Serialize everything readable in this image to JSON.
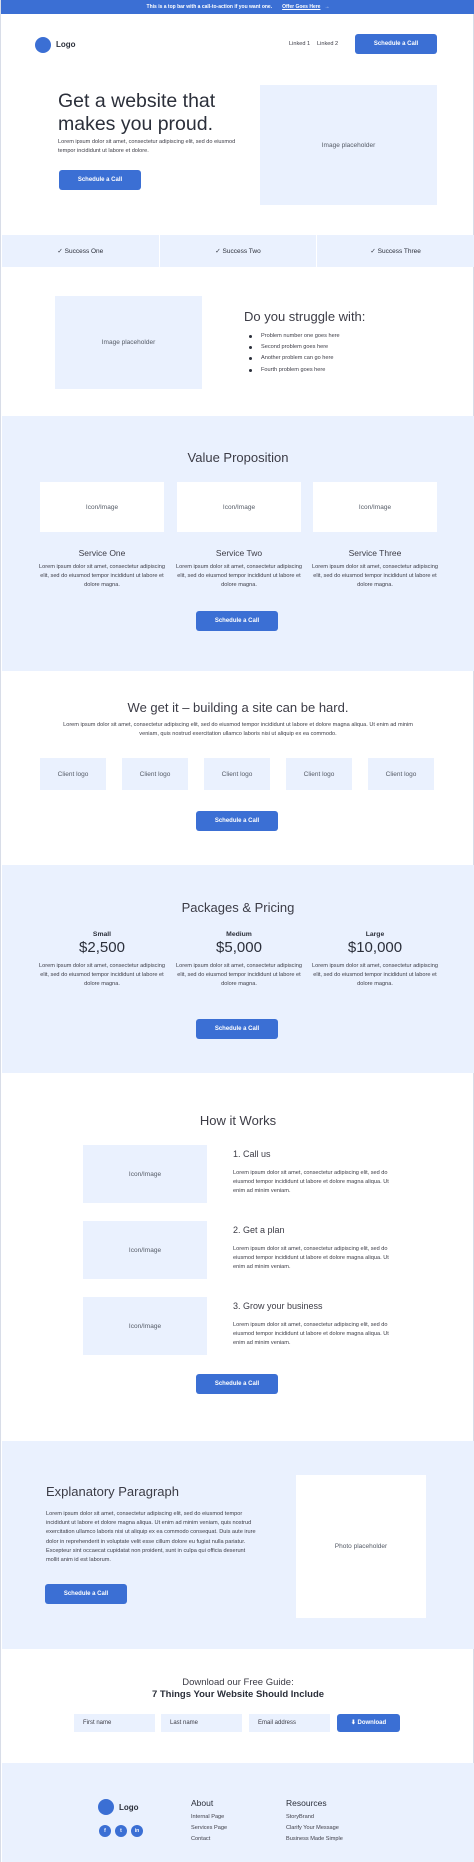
{
  "topbar": {
    "text": "This is a top bar with a call-to-action if you want one.",
    "link": "Offer Goes Here",
    "arrow": "→"
  },
  "header": {
    "logo": "Logo",
    "nav": [
      "Linked 1",
      "Linked 2"
    ],
    "cta": "Schedule a Call"
  },
  "hero": {
    "title_line1": "Get a website that",
    "title_line2": "makes you proud.",
    "text": "Lorem ipsum dolor sit amet, consectetur adipiscing elit, sed do eiusmod tempor incididunt ut labore et dolore.",
    "cta": "Schedule a Call",
    "image": "Image placeholder"
  },
  "success": [
    "✓ Success One",
    "✓ Success Two",
    "✓ Success Three"
  ],
  "struggle": {
    "image": "Image placeholder",
    "title": "Do you struggle with:",
    "items": [
      "Problem number one goes here",
      "Second problem goes here",
      "Another problem can go here",
      "Fourth problem goes here"
    ]
  },
  "value": {
    "title": "Value Proposition",
    "icon_label": "Icon/Image",
    "services": [
      {
        "title": "Service One",
        "text": "Lorem ipsum dolor sit amet, consectetur adipiscing elit, sed do eiusmod tempor incididunt ut labore et dolore magna."
      },
      {
        "title": "Service Two",
        "text": "Lorem ipsum dolor sit amet, consectetur adipiscing elit, sed do eiusmod tempor incididunt ut labore et dolore magna."
      },
      {
        "title": "Service Three",
        "text": "Lorem ipsum dolor sit amet, consectetur adipiscing elit, sed do eiusmod tempor incididunt ut labore et dolore magna."
      }
    ],
    "cta": "Schedule a Call"
  },
  "getit": {
    "title": "We get it – building a site can be hard.",
    "text": "Lorem ipsum dolor sit amet, consectetur adipiscing elit, sed do eiusmod tempor incididunt ut labore et dolore magna aliqua. Ut enim ad minim veniam, quis nostrud exercitation ullamco laboris nisi ut aliquip ex ea commodo.",
    "clients": [
      "Client logo",
      "Client logo",
      "Client logo",
      "Client logo",
      "Client logo"
    ],
    "cta": "Schedule a Call"
  },
  "pricing": {
    "title": "Packages & Pricing",
    "packages": [
      {
        "name": "Small",
        "price": "$2,500",
        "text": "Lorem ipsum dolor sit amet, consectetur adipiscing elit, sed do eiusmod tempor incididunt ut labore et dolore magna."
      },
      {
        "name": "Medium",
        "price": "$5,000",
        "text": "Lorem ipsum dolor sit amet, consectetur adipiscing elit, sed do eiusmod tempor incididunt ut labore et dolore magna."
      },
      {
        "name": "Large",
        "price": "$10,000",
        "text": "Lorem ipsum dolor sit amet, consectetur adipiscing elit, sed do eiusmod tempor incididunt ut labore et dolore magna."
      }
    ],
    "cta": "Schedule a Call"
  },
  "how": {
    "title": "How it Works",
    "icon_label": "Icon/Image",
    "steps": [
      {
        "title": "1. Call us",
        "text": "Lorem ipsum dolor sit amet, consectetur adipiscing elit, sed do eiusmod tempor incididunt ut labore et dolore magna aliqua. Ut enim ad minim veniam."
      },
      {
        "title": "2. Get a plan",
        "text": "Lorem ipsum dolor sit amet, consectetur adipiscing elit, sed do eiusmod tempor incididunt ut labore et dolore magna aliqua. Ut enim ad minim veniam."
      },
      {
        "title": "3. Grow your business",
        "text": "Lorem ipsum dolor sit amet, consectetur adipiscing elit, sed do eiusmod tempor incididunt ut labore et dolore magna aliqua. Ut enim ad minim veniam."
      }
    ],
    "cta": "Schedule a Call"
  },
  "explanatory": {
    "title": "Explanatory Paragraph",
    "text": "Lorem ipsum dolor sit amet, consectetur adipiscing elit, sed do eiusmod tempor incididunt ut labore et dolore magna aliqua. Ut enim ad minim veniam, quis nostrud exercitation ullamco laboris nisi ut aliquip ex ea commodo consequat. Duis aute irure dolor in reprehenderit in voluptate velit esse cillum dolore eu fugiat nulla pariatur. Excepteur sint occaecat cupidatat non proident, sunt in culpa qui officia deserunt mollit anim id est laborum.",
    "cta": "Schedule a Call",
    "photo": "Photo placeholder"
  },
  "guide": {
    "line1": "Download our Free Guide:",
    "line2": "7 Things Your Website Should Include",
    "first_name": "First name",
    "last_name": "Last name",
    "email": "Email address",
    "download": "⬇ Download"
  },
  "footer": {
    "logo": "Logo",
    "social": [
      "f",
      "t",
      "in"
    ],
    "about_title": "About",
    "about_links": [
      "Internal Page",
      "Services Page",
      "Contact"
    ],
    "resources_title": "Resources",
    "resource_links": [
      "StoryBrand",
      "Clarify Your Message",
      "Business Made Simple"
    ]
  },
  "colors": {
    "accent": "#3b6fd4",
    "light_bg": "#eaf1fe",
    "text": "#3c3c46"
  }
}
